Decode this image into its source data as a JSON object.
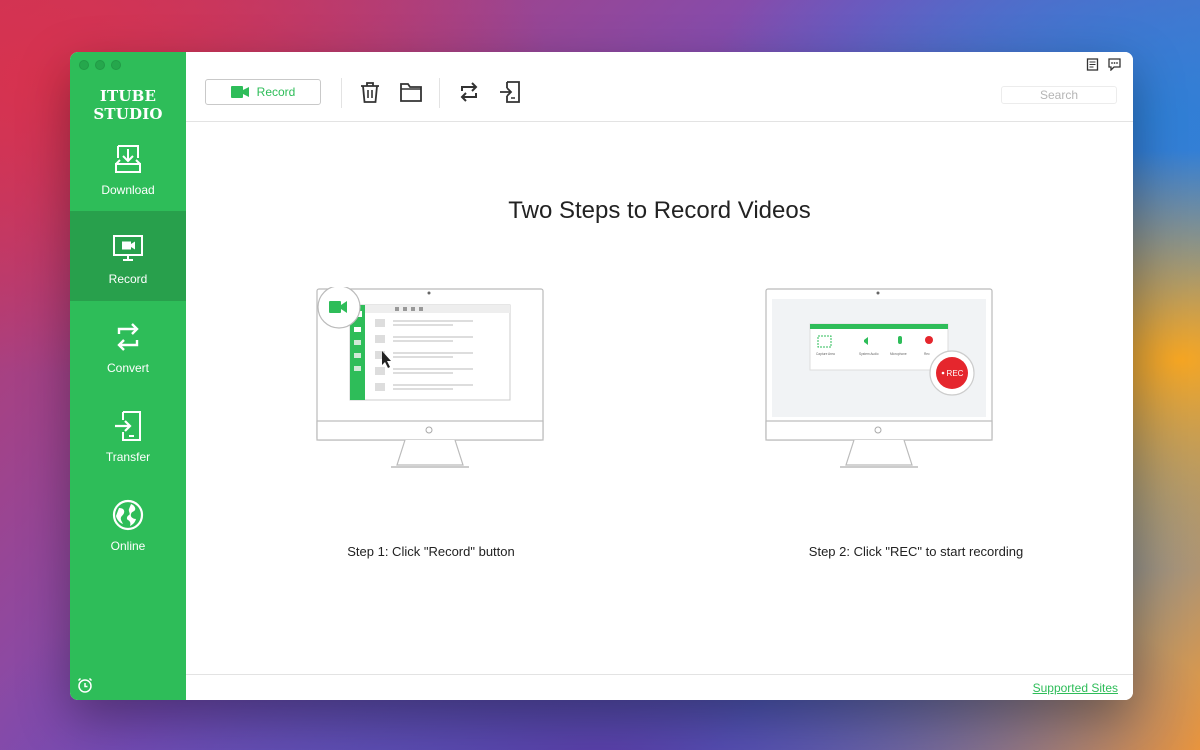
{
  "app": {
    "brand": "ITUBE STUDIO"
  },
  "sidebar": {
    "items": [
      {
        "label": "Download",
        "icon": "download-icon"
      },
      {
        "label": "Record",
        "icon": "monitor-icon",
        "active": true
      },
      {
        "label": "Convert",
        "icon": "convert-icon"
      },
      {
        "label": "Transfer",
        "icon": "transfer-icon"
      },
      {
        "label": "Online",
        "icon": "globe-icon"
      }
    ],
    "bottom_icon": "alarm-clock-icon"
  },
  "toolbar": {
    "record_label": "Record",
    "icons": [
      "trash-icon",
      "folder-icon",
      "repeat-icon",
      "import-icon"
    ],
    "search_placeholder": "Search",
    "top_right_icons": [
      "notes-icon",
      "chat-icon"
    ]
  },
  "main": {
    "title": "Two Steps to Record Videos",
    "steps": [
      {
        "caption": "Step 1: Click \"Record\" button"
      },
      {
        "caption": "Step 2: Click \"REC\" to start recording"
      }
    ],
    "rec_badge": "REC",
    "mini_labels": [
      "Capture Area",
      "System Audio",
      "Microphone",
      "Rec"
    ]
  },
  "footer": {
    "supported_sites": "Supported Sites"
  },
  "colors": {
    "brand_green": "#2ebd59",
    "active_green": "#28a04c",
    "rec_red": "#e5262d"
  }
}
